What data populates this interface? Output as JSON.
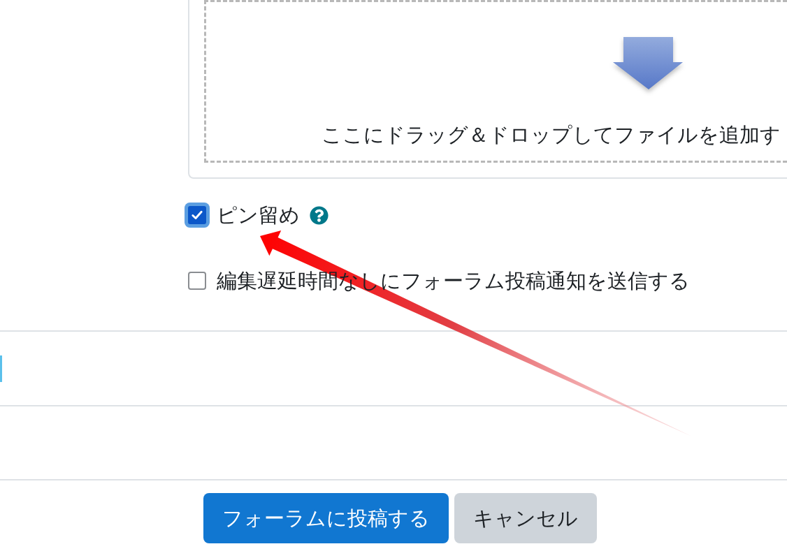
{
  "file_dropzone": {
    "instruction": "ここにドラッグ＆ドロップしてファイルを追加す"
  },
  "options": [
    {
      "label": "ピン留め",
      "checked": true,
      "focused": true,
      "help": true
    },
    {
      "label": "編集遅延時間なしにフォーラム投稿通知を送信する",
      "checked": false,
      "focused": false,
      "help": false
    }
  ],
  "buttons": [
    {
      "label": "フォーラムに投稿する",
      "kind": "primary"
    },
    {
      "label": "キャンセル",
      "kind": "secondary"
    }
  ]
}
